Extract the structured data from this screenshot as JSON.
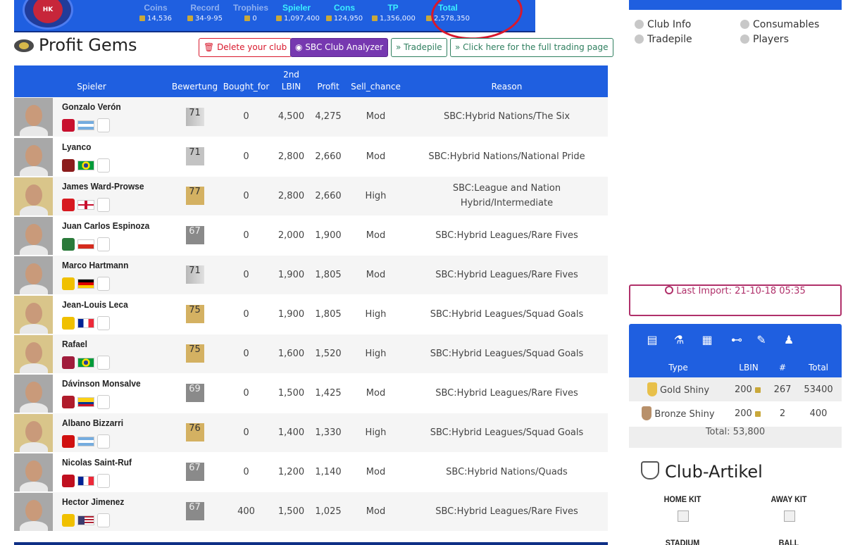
{
  "header_stats": [
    {
      "label": "Coins",
      "value": "14,536",
      "highlight": false
    },
    {
      "label": "Record",
      "value": "34-9-95",
      "highlight": false
    },
    {
      "label": "Trophies",
      "value": "0",
      "highlight": false
    },
    {
      "label": "Spieler",
      "value": "1,097,400",
      "highlight": true
    },
    {
      "label": "Cons",
      "value": "124,950",
      "highlight": true
    },
    {
      "label": "TP",
      "value": "1,356,000",
      "highlight": true
    },
    {
      "label": "Total",
      "value": "2,578,350",
      "highlight": true
    }
  ],
  "logo_text": "HK",
  "page": {
    "title": "Profit Gems"
  },
  "buttons": {
    "delete_club": "Delete your club",
    "sbc_analyzer": "SBC Club Analyzer",
    "tradepile": "» Tradepile",
    "full_trading": "» Click here for the full trading page"
  },
  "table": {
    "headers": {
      "player": "Spieler",
      "rating": "Bewertung",
      "bought": "Bought_for",
      "lbin": "2nd LBIN",
      "profit": "Profit",
      "sell": "Sell_chance",
      "reason": "Reason"
    },
    "rows": [
      {
        "name": "Gonzalo Verón",
        "rating": "71",
        "rtype": "silverrare",
        "bought": "0",
        "lbin": "4,500",
        "profit": "4,275",
        "sell": "Mod",
        "reason": "SBC:Hybrid Nations/The Six",
        "club": "#c8102e",
        "flag": "argentina",
        "avatar": "gray"
      },
      {
        "name": "Lyanco",
        "rating": "71",
        "rtype": "silver",
        "bought": "0",
        "lbin": "2,800",
        "profit": "2,660",
        "sell": "Mod",
        "reason": "SBC:Hybrid Nations/National Pride",
        "club": "#8b1c1c",
        "flag": "brazil",
        "avatar": "gray"
      },
      {
        "name": "James Ward-Prowse",
        "rating": "77",
        "rtype": "gold",
        "bought": "0",
        "lbin": "2,800",
        "profit": "2,660",
        "sell": "High",
        "reason": "SBC:League and Nation Hybrid/Intermediate",
        "club": "#d71920",
        "flag": "england",
        "avatar": "gold"
      },
      {
        "name": "Juan Carlos Espinoza",
        "rating": "67",
        "rtype": "gray",
        "bought": "0",
        "lbin": "2,000",
        "profit": "1,900",
        "sell": "Mod",
        "reason": "SBC:Hybrid Leagues/Rare Fives",
        "club": "#2a7a3a",
        "flag": "chile",
        "avatar": "gray"
      },
      {
        "name": "Marco Hartmann",
        "rating": "71",
        "rtype": "silverrare",
        "bought": "0",
        "lbin": "1,900",
        "profit": "1,805",
        "sell": "Mod",
        "reason": "SBC:Hybrid Leagues/Rare Fives",
        "club": "#f0c000",
        "flag": "germany",
        "avatar": "gray"
      },
      {
        "name": "Jean-Louis Leca",
        "rating": "75",
        "rtype": "gold",
        "bought": "0",
        "lbin": "1,900",
        "profit": "1,805",
        "sell": "High",
        "reason": "SBC:Hybrid Leagues/Squad Goals",
        "club": "#f0c000",
        "flag": "france",
        "avatar": "gold"
      },
      {
        "name": "Rafael",
        "rating": "75",
        "rtype": "gold",
        "bought": "0",
        "lbin": "1,600",
        "profit": "1,520",
        "sell": "High",
        "reason": "SBC:Hybrid Leagues/Squad Goals",
        "club": "#a01c3c",
        "flag": "brazil",
        "avatar": "gold"
      },
      {
        "name": "Dávinson Monsalve",
        "rating": "69",
        "rtype": "gray",
        "bought": "0",
        "lbin": "1,500",
        "profit": "1,425",
        "sell": "Mod",
        "reason": "SBC:Hybrid Leagues/Rare Fives",
        "club": "#b01c2c",
        "flag": "colombia",
        "avatar": "gray"
      },
      {
        "name": "Albano Bizzarri",
        "rating": "76",
        "rtype": "gold",
        "bought": "0",
        "lbin": "1,400",
        "profit": "1,330",
        "sell": "High",
        "reason": "SBC:Hybrid Leagues/Squad Goals",
        "club": "#d01010",
        "flag": "argentina",
        "avatar": "gold"
      },
      {
        "name": "Nicolas Saint-Ruf",
        "rating": "67",
        "rtype": "gray",
        "bought": "0",
        "lbin": "1,200",
        "profit": "1,140",
        "sell": "Mod",
        "reason": "SBC:Hybrid Nations/Quads",
        "club": "#c01020",
        "flag": "france",
        "avatar": "gray"
      },
      {
        "name": "Hector Jimenez",
        "rating": "67",
        "rtype": "gray",
        "bought": "400",
        "lbin": "1,500",
        "profit": "1,025",
        "sell": "Mod",
        "reason": "SBC:Hybrid Leagues/Rare Fives",
        "club": "#f0c000",
        "flag": "usa",
        "avatar": "gray"
      }
    ]
  },
  "sidebar": {
    "categories": [
      "Club Info",
      "Consumables",
      "Tradepile",
      "Players"
    ],
    "last_import": "Last Import: 21-10-18 05:35",
    "table_headers": {
      "type": "Type",
      "lbin": "LBIN",
      "count": "#",
      "total": "Total"
    },
    "rows": [
      {
        "type": "Gold Shiny",
        "lbin": "200",
        "count": "267",
        "total": "53400",
        "color": "#e8c04a"
      },
      {
        "type": "Bronze Shiny",
        "lbin": "200",
        "count": "2",
        "total": "400",
        "color": "#b8906a"
      }
    ],
    "total": "Total: 53,800",
    "club_title": "Club-Artikel",
    "kits": [
      "HOME KIT",
      "AWAY KIT",
      "STADIUM",
      "BALL"
    ]
  },
  "colors": {
    "header_blue": "#1f5fe0",
    "profit_green": "#4caf50",
    "highlight_red": "#d8182c",
    "import_border": "#b0306a"
  }
}
